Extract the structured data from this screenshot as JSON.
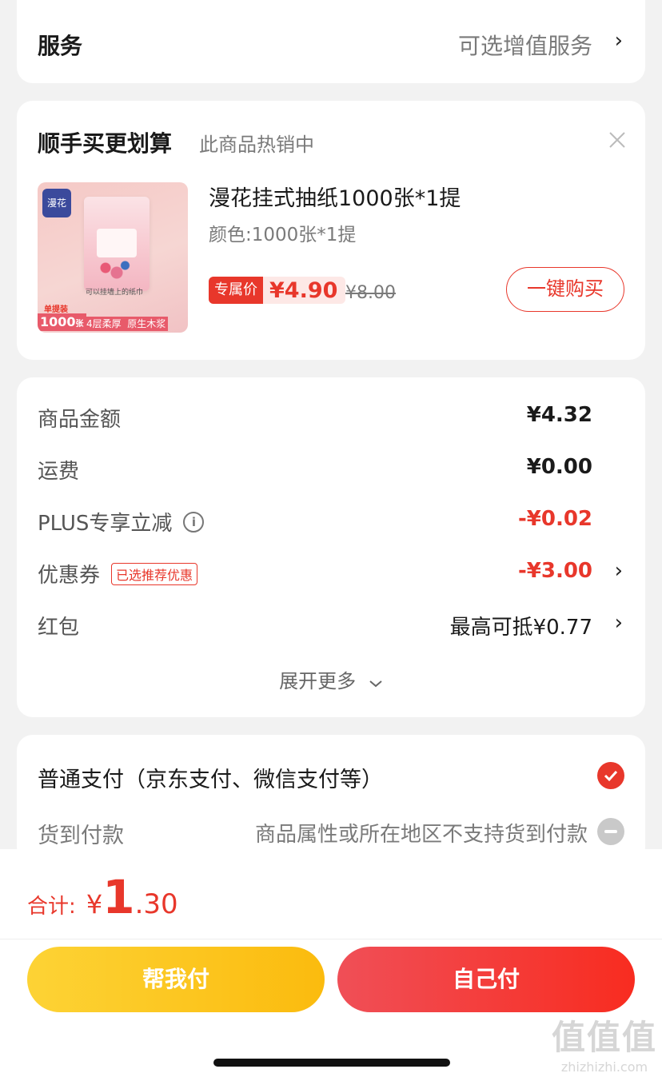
{
  "service": {
    "title": "服务",
    "value": "可选增值服务"
  },
  "upsell": {
    "title": "顺手买更划算",
    "subtitle": "此商品热销中",
    "product": {
      "name": "漫花挂式抽纸1000张*1提",
      "variant": "颜色:1000张*1提",
      "badge_label": "专属价",
      "price": "¥4.90",
      "original_price": "¥8.00",
      "buy_label": "一键购买",
      "image": {
        "brand": "漫花",
        "count_top": "单提装",
        "count": "1000",
        "count_unit": "张",
        "hang_text": "可以挂墙上的纸巾",
        "features": "4层柔厚  原生木浆"
      }
    }
  },
  "summary": {
    "goods_label": "商品金额",
    "goods_value": "¥4.32",
    "shipping_label": "运费",
    "shipping_value": "¥0.00",
    "plus_label": "PLUS专享立减",
    "plus_value": "-¥0.02",
    "coupon_label": "优惠券",
    "coupon_badge": "已选推荐优惠",
    "coupon_value": "-¥3.00",
    "redpacket_label": "红包",
    "redpacket_value": "最高可抵¥0.77",
    "expand_label": "展开更多"
  },
  "payment": {
    "normal_label": "普通支付（京东支付、微信支付等）",
    "cod_label": "货到付款",
    "cod_note": "商品属性或所在地区不支持货到付款"
  },
  "footer": {
    "total_label": "合计:",
    "currency": "¥",
    "total_int": "1",
    "total_dec": ".30",
    "help_pay_label": "帮我付",
    "self_pay_label": "自己付"
  },
  "watermark": {
    "logo": "值值值",
    "site": "zhizhizhi.com"
  },
  "colors": {
    "accent": "#e8372b",
    "yellow_start": "#fdd335",
    "yellow_end": "#fbbb0e",
    "red_start": "#f04f57",
    "red_end": "#f82c20"
  }
}
